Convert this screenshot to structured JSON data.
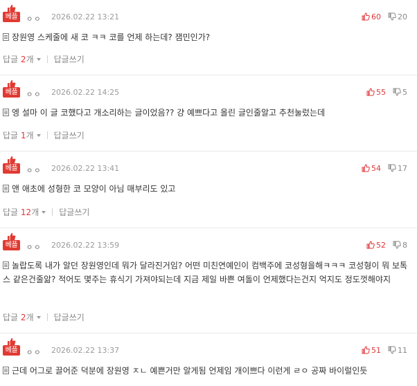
{
  "badge_label": "베플",
  "reply_label": "답글",
  "reply_unit": "개",
  "write_reply": "답글쓰기",
  "nick_placeholder": "ㅇㅇ",
  "comments": [
    {
      "date": "2026.02.22 13:21",
      "up": "60",
      "down": "20",
      "text": "장원영 스케줄에 새 코 ㅋㅋ 코를 언제 하는데? 잼민인가?",
      "replies": "2"
    },
    {
      "date": "2026.02.22 14:25",
      "up": "55",
      "down": "5",
      "text": "엥 설마 이 글 코했다고 개소리하는 글이었음?? 걍 예쁘다고 올린 글인줄알고 추천눌렀는데",
      "replies": "1"
    },
    {
      "date": "2026.02.22 13:41",
      "up": "54",
      "down": "17",
      "text": "앤 애초에 성형한 코 모양이 아님 매부리도 있고",
      "replies": "12"
    },
    {
      "date": "2026.02.22 13:59",
      "up": "52",
      "down": "8",
      "text": "놀랍도록 내가 알던 장원영인데 뭐가 달라진거임? 어떤 미친연예인이 컴백주에 코성형을해ㅋㅋㅋ 코성형이 뭐 보톡스 같은건줄앎? 적어도 몇주는 휴식기 가져야되는데 지금 제일 바쁜 여돌이 언제했다는건지 억지도 정도껏해야지",
      "replies": "2"
    },
    {
      "date": "2026.02.22 13:37",
      "up": "51",
      "down": "11",
      "text": "근데 어그로 끌어준 덕분에 장원영 ㅈㄴ 예쁜거만 알게됨 언제임 개이쁘다 이런게 ㄹㅇ 공짜 바이럴인듯",
      "replies": ""
    }
  ],
  "colors": {
    "accent": "#e0363a",
    "badge": "#e03a32"
  },
  "icons": [
    "thumbs-up-icon",
    "thumbs-down-icon",
    "document-icon",
    "dropdown-arrow-icon"
  ]
}
